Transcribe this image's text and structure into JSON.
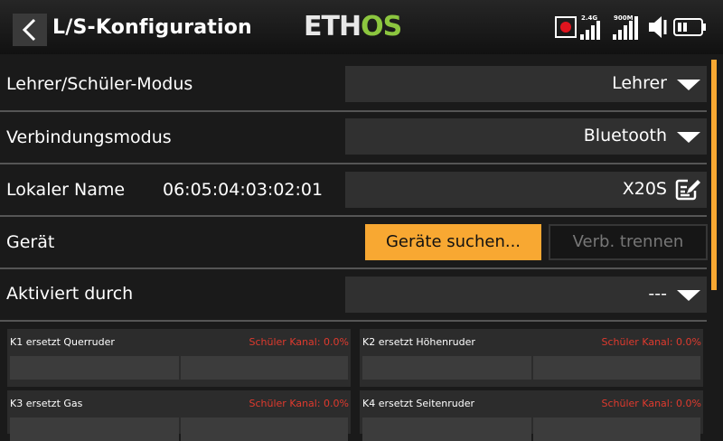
{
  "header": {
    "title": "L/S-Konfiguration",
    "logo_left": "ETH",
    "logo_right": "OS",
    "signal_24_label": "2.4G",
    "signal_900_label": "900M"
  },
  "colors": {
    "accent": "#f8a832",
    "logo_green": "#8cc63f",
    "alert_red": "#e03a2e"
  },
  "rows": {
    "mode_label": "Lehrer/Schüler-Modus",
    "mode_value": "Lehrer",
    "connection_label": "Verbindungsmodus",
    "connection_value": "Bluetooth",
    "local_name_label": "Lokaler Name",
    "local_address": "06:05:04:03:02:01",
    "local_name_value": "X20S",
    "device_label": "Gerät",
    "search_button": "Geräte suchen...",
    "disconnect_button": "Verb. trennen",
    "activated_label": "Aktiviert durch",
    "activated_value": "---"
  },
  "channels": [
    {
      "title": "K1 ersetzt Querruder",
      "status": "Schüler Kanal: 0.0%"
    },
    {
      "title": "K2 ersetzt Höhenruder",
      "status": "Schüler Kanal: 0.0%"
    },
    {
      "title": "K3 ersetzt Gas",
      "status": "Schüler Kanal: 0.0%"
    },
    {
      "title": "K4 ersetzt Seitenruder",
      "status": "Schüler Kanal: 0.0%"
    }
  ]
}
